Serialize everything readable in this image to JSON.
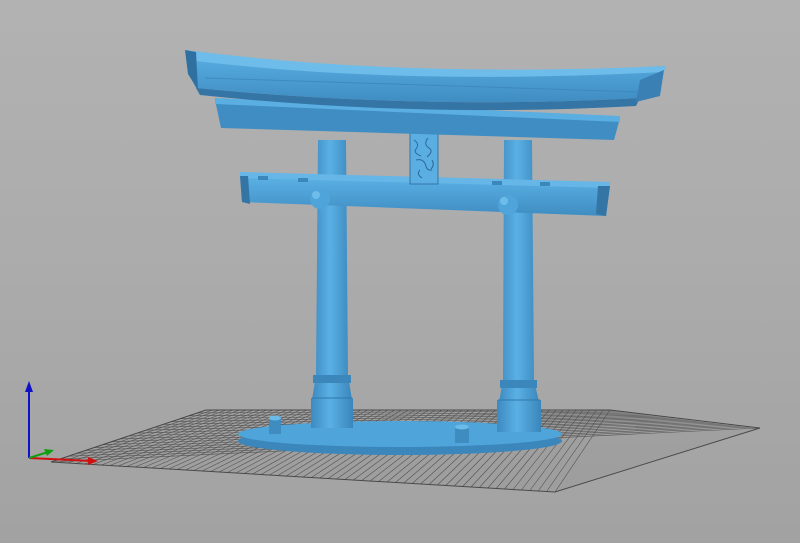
{
  "app": {
    "view": "3d-viewport"
  },
  "scene": {
    "background_color": "#aaaaaa",
    "model": {
      "name": "torii-gate",
      "color": "#4a9fd6",
      "shade_color": "#3b88bd",
      "highlight_color": "#66b6e8"
    },
    "build_plate": {
      "grid": true,
      "grid_color": "#3a3a3a"
    },
    "axes": {
      "x_color": "#d01010",
      "y_color": "#10a010",
      "z_color": "#1010c8"
    }
  }
}
